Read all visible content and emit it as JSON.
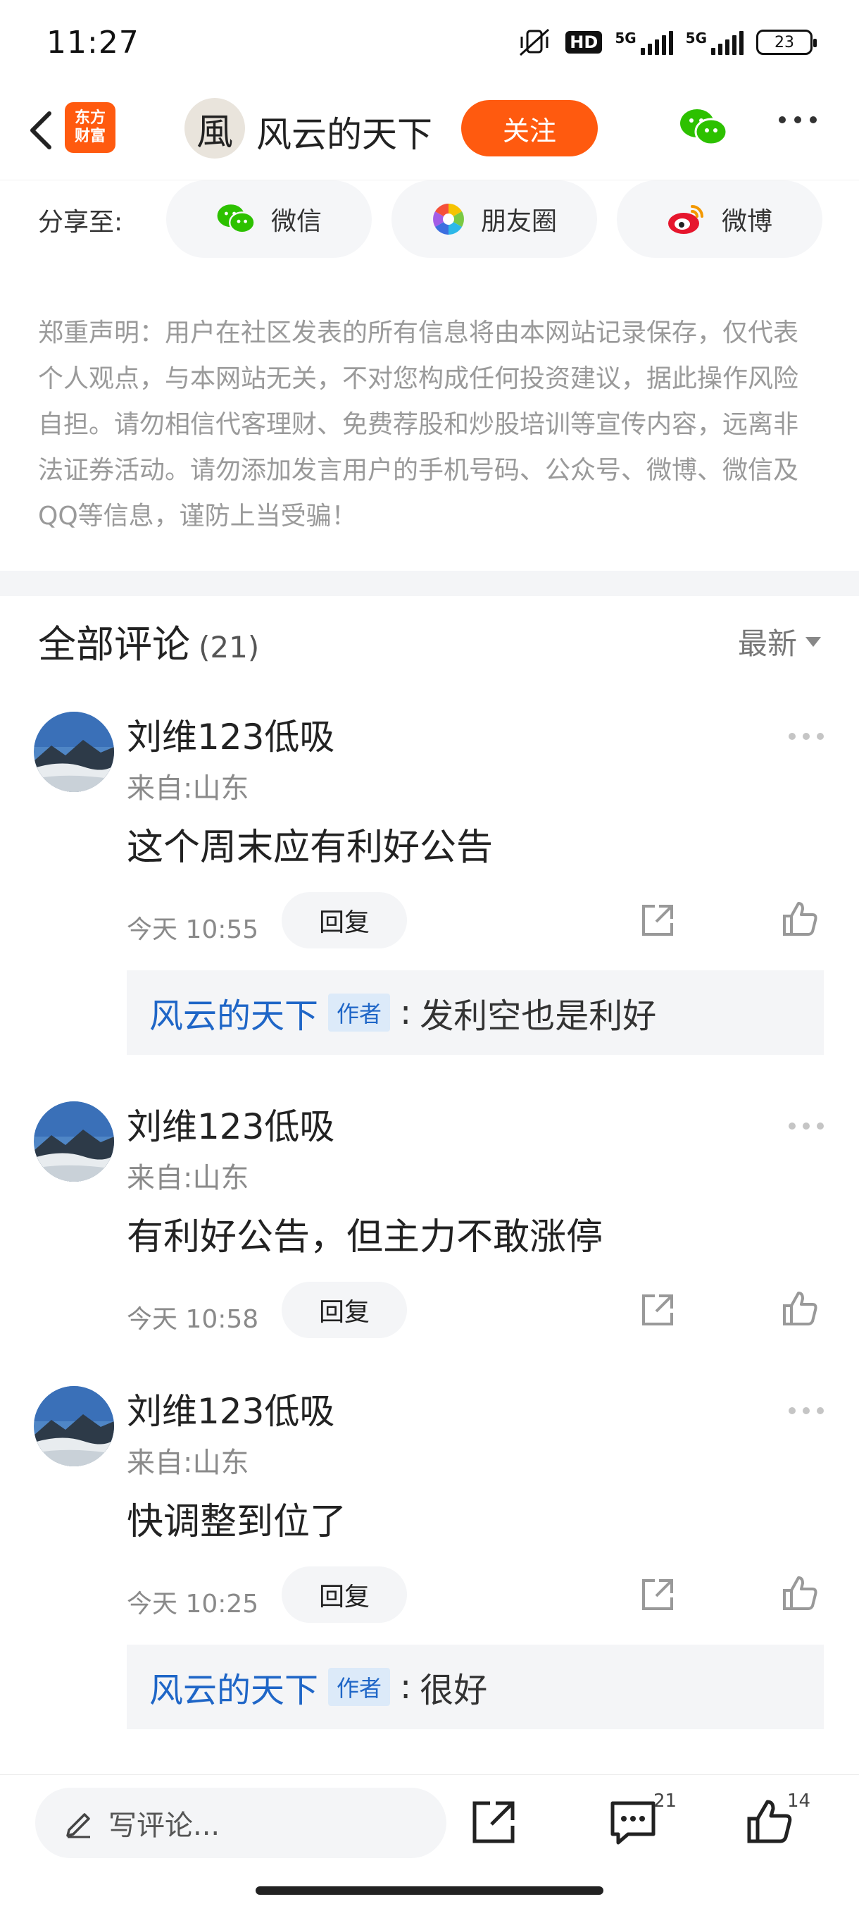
{
  "status_bar": {
    "time": "11:27",
    "hd_label": "HD",
    "network_1": "5G",
    "network_2": "5G",
    "battery": "23"
  },
  "nav": {
    "logo_line1": "东方",
    "logo_line2": "财富",
    "author_avatar_glyph": "風",
    "author_name": "风云的天下",
    "follow_label": "关注",
    "accent_color": "#ff5a0f"
  },
  "share": {
    "label": "分享至:",
    "options": [
      {
        "label": "微信",
        "icon": "wechat-icon"
      },
      {
        "label": "朋友圈",
        "icon": "moments-icon"
      },
      {
        "label": "微博",
        "icon": "weibo-icon"
      }
    ]
  },
  "disclaimer": "郑重声明：用户在社区发表的所有信息将由本网站记录保存，仅代表个人观点，与本网站无关，不对您构成任何投资建议，据此操作风险自担。请勿相信代客理财、免费荐股和炒股培训等宣传内容，远离非法证券活动。请勿添加发言用户的手机号码、公众号、微博、微信及QQ等信息，谨防上当受骗！",
  "comments_section": {
    "title": "全部评论",
    "count": "(21)",
    "sort_label": "最新"
  },
  "comments": [
    {
      "user": "刘维123低吸",
      "location": "来自:山东",
      "text": "这个周末应有利好公告",
      "time": "今天 10:55",
      "reply_label": "回复",
      "author_reply": {
        "name": "风云的天下",
        "badge": "作者",
        "colon": ":",
        "text": "发利空也是利好"
      }
    },
    {
      "user": "刘维123低吸",
      "location": "来自:山东",
      "text": "有利好公告，但主力不敢涨停",
      "time": "今天 10:58",
      "reply_label": "回复"
    },
    {
      "user": "刘维123低吸",
      "location": "来自:山东",
      "text": "快调整到位了",
      "time": "今天 10:25",
      "reply_label": "回复",
      "author_reply": {
        "name": "风云的天下",
        "badge": "作者",
        "colon": ":",
        "text": "很好"
      }
    }
  ],
  "bottom_bar": {
    "write_placeholder": "写评论...",
    "comment_count": "21",
    "like_count": "14"
  }
}
